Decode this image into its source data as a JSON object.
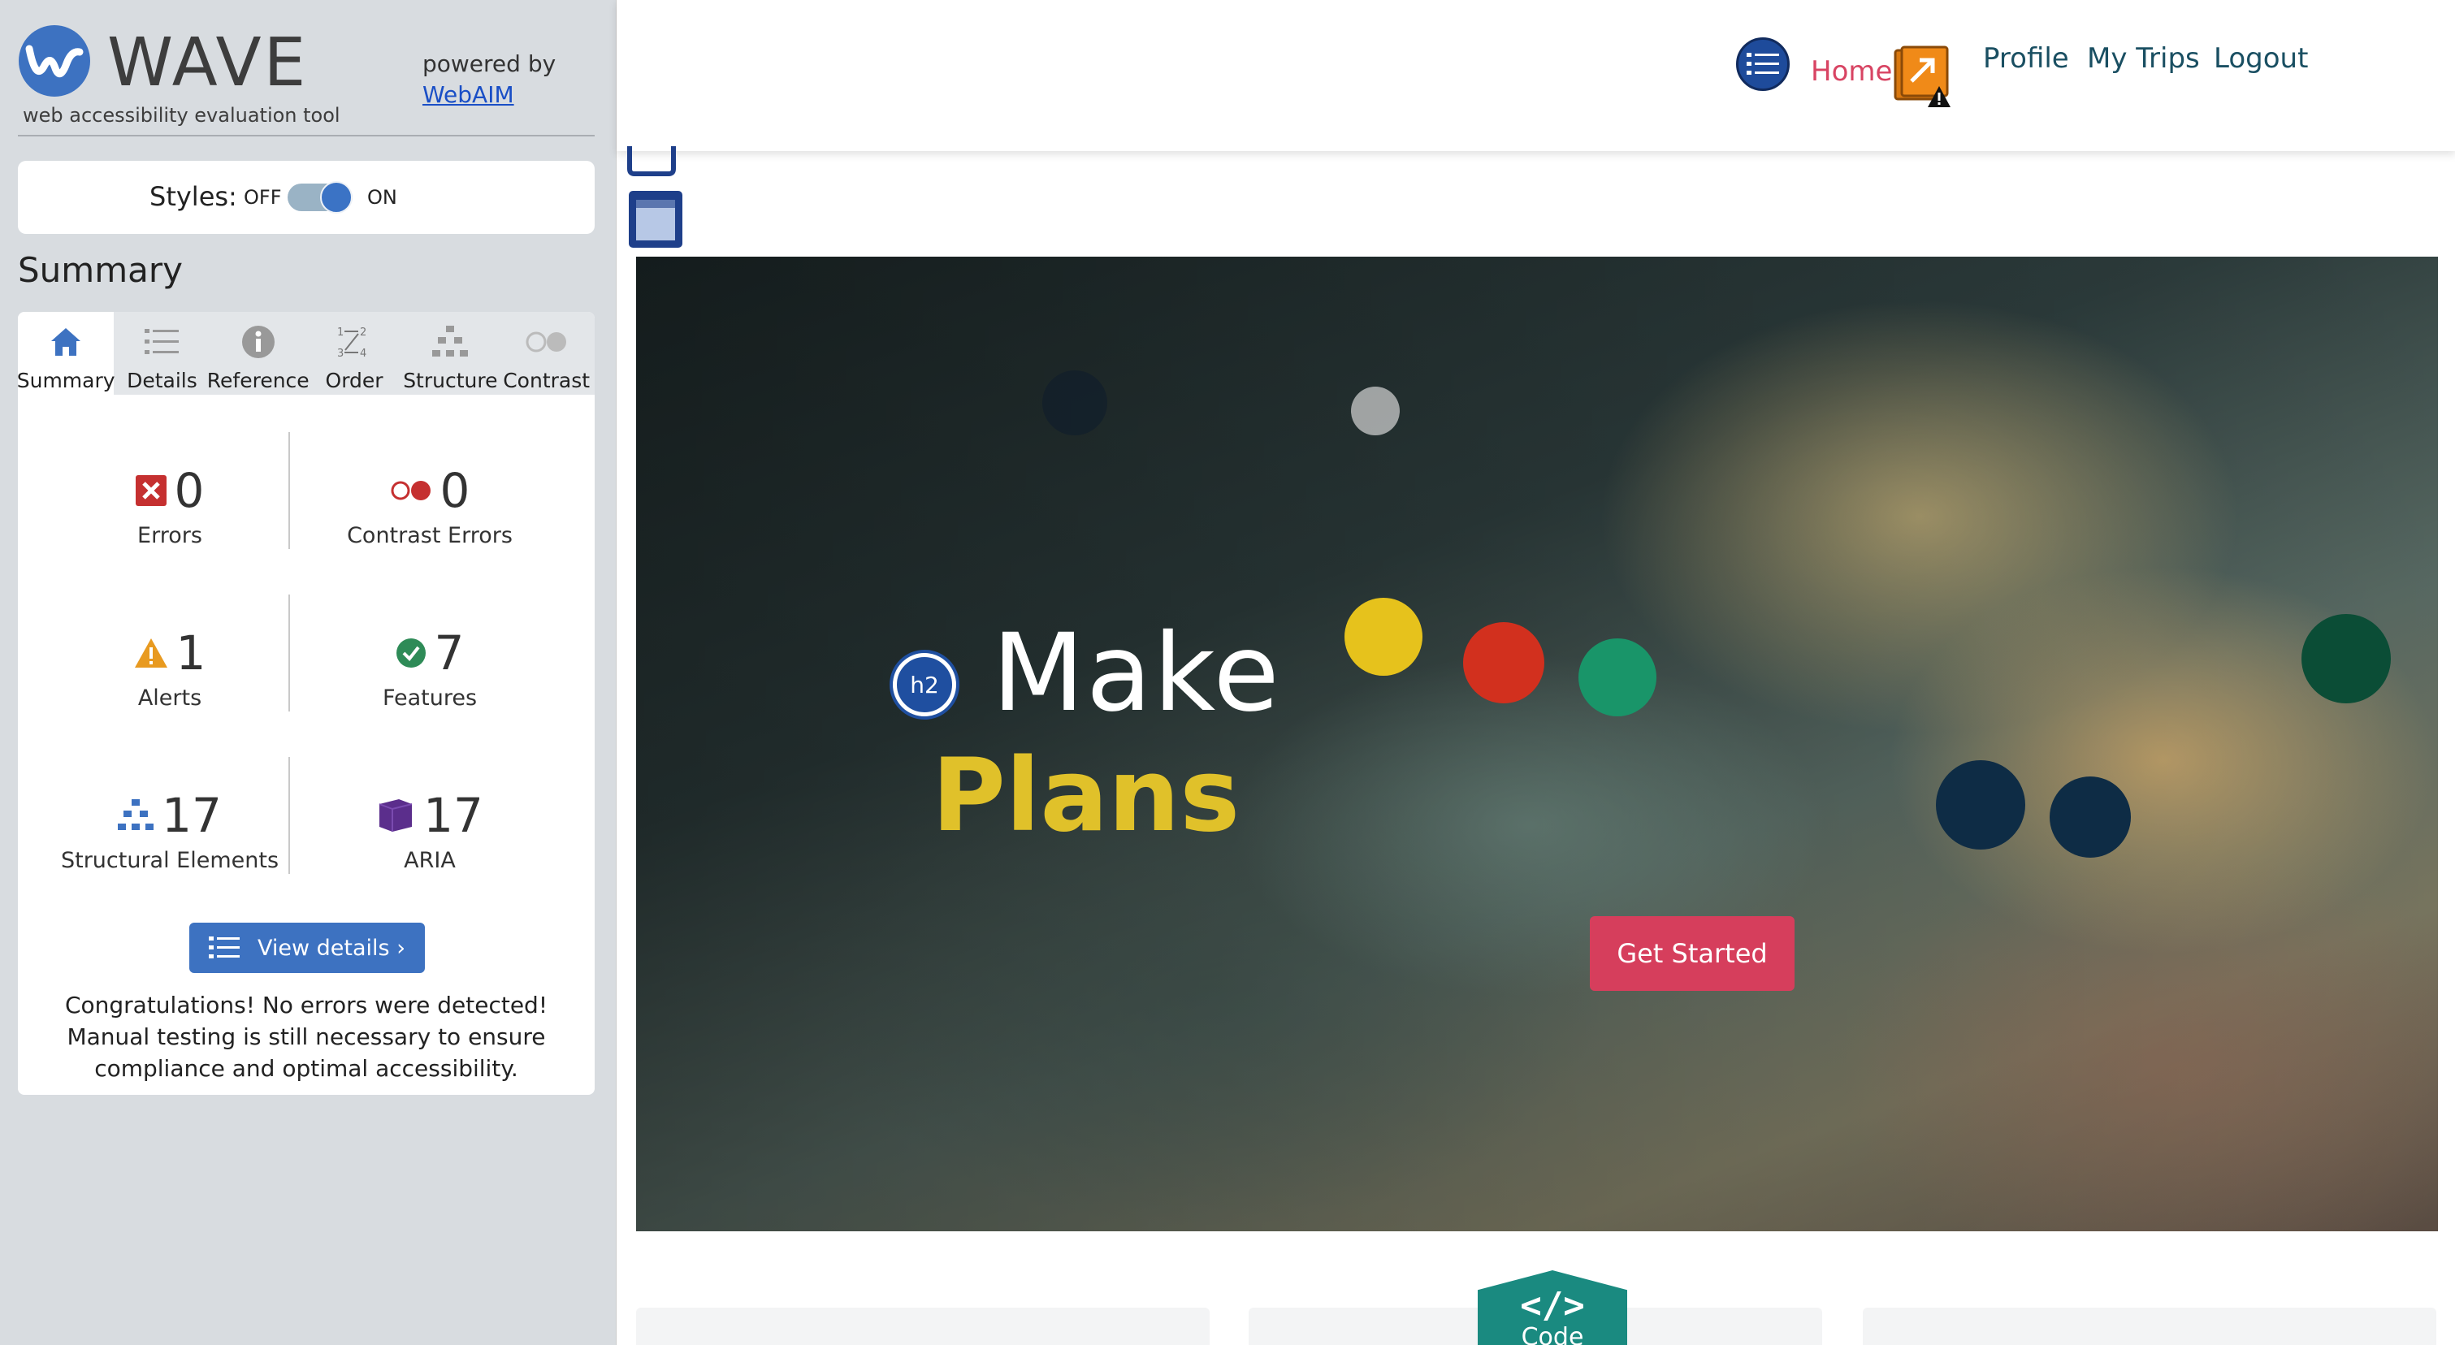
{
  "wave": {
    "title": "WAVE",
    "subtitle": "web accessibility evaluation tool",
    "powered_by": "powered by",
    "webaim_link": "WebAIM",
    "styles": {
      "label": "Styles:",
      "off": "OFF",
      "on": "ON",
      "state": "on"
    },
    "summary_heading": "Summary",
    "tabs": [
      {
        "label": "Summary",
        "icon": "home-icon",
        "active": true
      },
      {
        "label": "Details",
        "icon": "list-icon"
      },
      {
        "label": "Reference",
        "icon": "info-icon"
      },
      {
        "label": "Order",
        "icon": "order-icon"
      },
      {
        "label": "Structure",
        "icon": "structure-icon"
      },
      {
        "label": "Contrast",
        "icon": "contrast-icon"
      }
    ],
    "stats": {
      "errors": {
        "value": "0",
        "label": "Errors",
        "icon": "error-icon"
      },
      "contrast_errors": {
        "value": "0",
        "label": "Contrast Errors",
        "icon": "contrast-error-icon"
      },
      "alerts": {
        "value": "1",
        "label": "Alerts",
        "icon": "alert-icon"
      },
      "features": {
        "value": "7",
        "label": "Features",
        "icon": "feature-check-icon"
      },
      "structural": {
        "value": "17",
        "label": "Structural Elements",
        "icon": "structure-icon"
      },
      "aria": {
        "value": "17",
        "label": "ARIA",
        "icon": "aria-cube-icon"
      }
    },
    "view_details": "View details ›",
    "congrats": "Congratulations! No errors were detected! Manual testing is still necessary to ensure compliance and optimal accessibility."
  },
  "site": {
    "nav": {
      "home": "Home",
      "profile": "Profile",
      "trips": "My Trips",
      "logout": "Logout"
    },
    "hero": {
      "h2_badge": "h2",
      "line1": "Make",
      "line2": "Plans",
      "cta": "Get Started"
    },
    "code_badge": {
      "glyph": "</>",
      "label": "Code"
    }
  },
  "colors": {
    "wave_blue": "#3d72c1",
    "nav_text": "#1a4f62",
    "home_active": "#d84463",
    "plans_yellow": "#e0c12a",
    "cta": "#d63e5c",
    "code_teal": "#1a8a80"
  }
}
